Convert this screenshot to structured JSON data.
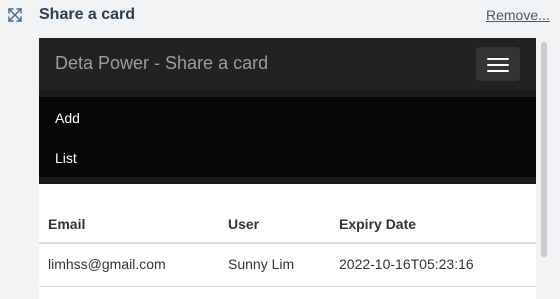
{
  "header": {
    "title": "Share a card",
    "remove_label": "Remove...",
    "collapse_icon": "collapse-arrows-icon"
  },
  "app": {
    "brand": "Deta Power - Share a card",
    "menu_icon": "hamburger-menu-icon",
    "menu_items": [
      {
        "label": "Add"
      },
      {
        "label": "List"
      }
    ]
  },
  "table": {
    "columns": [
      "Email",
      "User",
      "Expiry Date"
    ],
    "rows": [
      {
        "email": "limhss@gmail.com",
        "user": "Sunny Lim",
        "expiry": "2022-10-16T05:23:16"
      }
    ]
  },
  "colors": {
    "navbar_bg": "#222222",
    "menu_bg": "#060606",
    "title_color": "#2c3e50"
  }
}
